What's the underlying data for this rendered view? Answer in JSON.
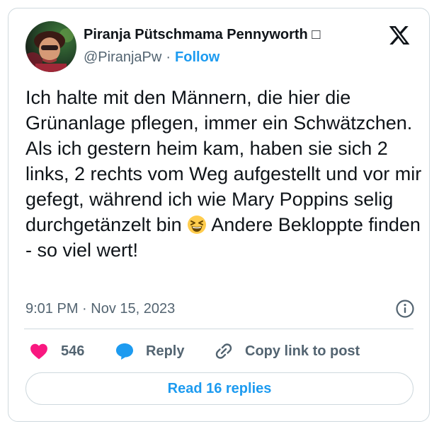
{
  "author": {
    "display_name": "Piranja Pütschmama Pennyworth □",
    "handle": "@PiranjaPw",
    "separator": "·",
    "follow_label": "Follow"
  },
  "tweet": {
    "text_before_emoji": "Ich halte mit den Männern, die hier die Grünanlage pflegen, immer ein Schwätzchen. Als ich gestern heim kam, haben sie sich 2 links, 2 rechts vom Weg aufgestellt und vor mir gefegt, während ich wie Mary Poppins selig durchgetänzelt bin",
    "emoji": "grinning-squinting-face",
    "text_after_emoji": "Andere Bekloppte finden - so viel wert!"
  },
  "meta": {
    "timestamp": "9:01 PM · Nov 15, 2023"
  },
  "actions": {
    "like_count": "546",
    "reply_label": "Reply",
    "copy_link_label": "Copy link to post"
  },
  "read_replies_label": "Read 16 replies",
  "colors": {
    "accent": "#1d9bf0",
    "like": "#f91880",
    "text": "#0f1419",
    "muted": "#536471",
    "border": "#cfd9de"
  },
  "icons": {
    "brand": "x-logo-icon",
    "info": "info-icon",
    "like": "heart-icon",
    "reply": "speech-bubble-icon",
    "copy": "link-icon"
  }
}
